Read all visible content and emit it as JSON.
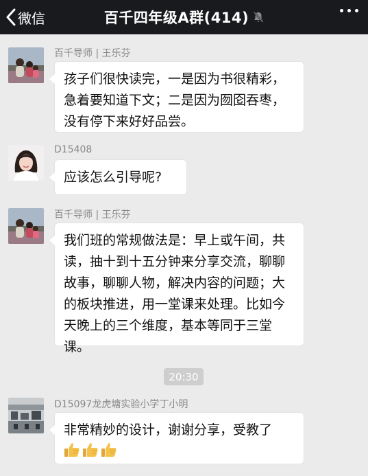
{
  "header": {
    "back_label": "微信",
    "title": "百千四年级A群(414)",
    "mute_icon": "bell-slash-icon",
    "more_icon": "more-dots-icon"
  },
  "messages": [
    {
      "sender": "百千导师 | 王乐芬",
      "text": "孩子们很快读完，一是因为书很精彩，急着要知道下文；二是因为囫囵吞枣，没有停下来好好品尝。"
    },
    {
      "sender": "D15408",
      "text": "应该怎么引导呢?"
    },
    {
      "sender": "百千导师 | 王乐芬",
      "text": "我们班的常规做法是：早上或午间，共读，抽十到十五分钟来分享交流，聊聊故事，聊聊人物，解决内容的问题；大的板块推进，用一堂课来处理。比如今天晚上的三个维度，基本等同于三堂课。"
    },
    {
      "sender": "D15097龙虎塘实验小学丁小明",
      "text": "非常精妙的设计，谢谢分享，受教了",
      "emoji": [
        "thumbs-up-icon",
        "thumbs-up-icon",
        "thumbs-up-icon"
      ]
    }
  ],
  "timestamp": "20:30",
  "colors": {
    "header_bg": "#191a1e",
    "chat_bg": "#ebebeb",
    "bubble_bg": "#ffffff",
    "sender_name": "#888888",
    "time_badge_bg": "#cecece"
  }
}
